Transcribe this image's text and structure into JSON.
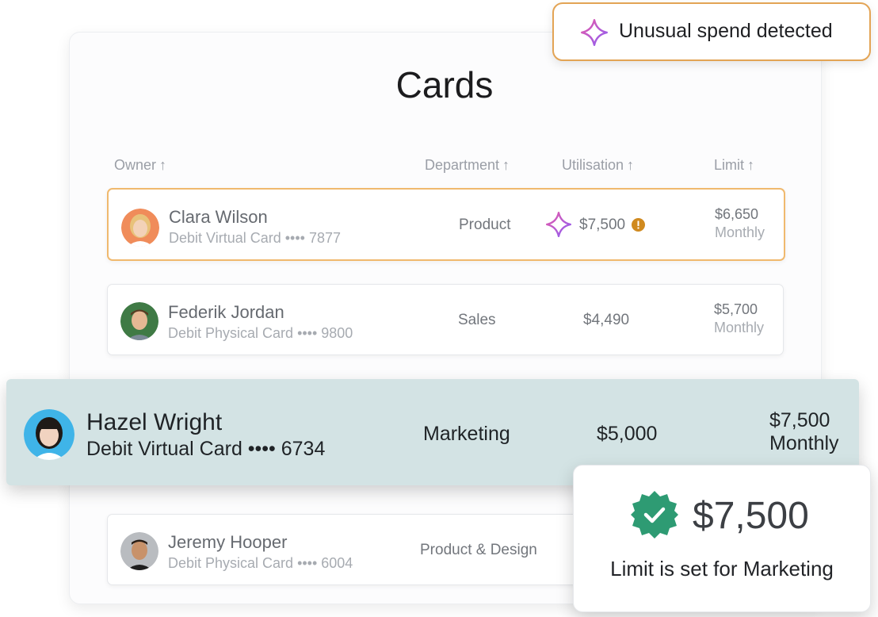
{
  "page": {
    "title": "Cards"
  },
  "columns": {
    "owner": "Owner",
    "department": "Department",
    "utilisation": "Utilisation",
    "limit": "Limit",
    "sort_glyph": "↑"
  },
  "alert": {
    "text": "Unusual spend detected",
    "icon": "sparkle-icon"
  },
  "rows": [
    {
      "name": "Clara Wilson",
      "card": "Debit Virtual Card •••• 7877",
      "department": "Product",
      "utilisation": "$7,500",
      "limit": "$6,650",
      "period": "Monthly",
      "flagged": true
    },
    {
      "name": "Federik Jordan",
      "card": "Debit Physical Card •••• 9800",
      "department": "Sales",
      "utilisation": "$4,490",
      "limit": "$5,700",
      "period": "Monthly",
      "flagged": false
    },
    {
      "name": "Hazel Wright",
      "card": "Debit Virtual Card •••• 6734",
      "department": "Marketing",
      "utilisation": "$5,000",
      "limit": "$7,500",
      "period": "Monthly",
      "flagged": false
    },
    {
      "name": "Jeremy Hooper",
      "card": "Debit Physical Card •••• 6004",
      "department": "Product & Design",
      "flagged": false
    }
  ],
  "confirmation": {
    "amount": "$7,500",
    "message": "Limit is set for Marketing",
    "icon": "verified-badge-icon"
  },
  "colors": {
    "accent_orange": "#e3a455",
    "highlight_row": "#d3e3e4",
    "badge_green": "#2e9b73",
    "warning": "#d08a1f",
    "sparkle_pink": "#e85aa8",
    "sparkle_purple": "#8b5cf6"
  }
}
